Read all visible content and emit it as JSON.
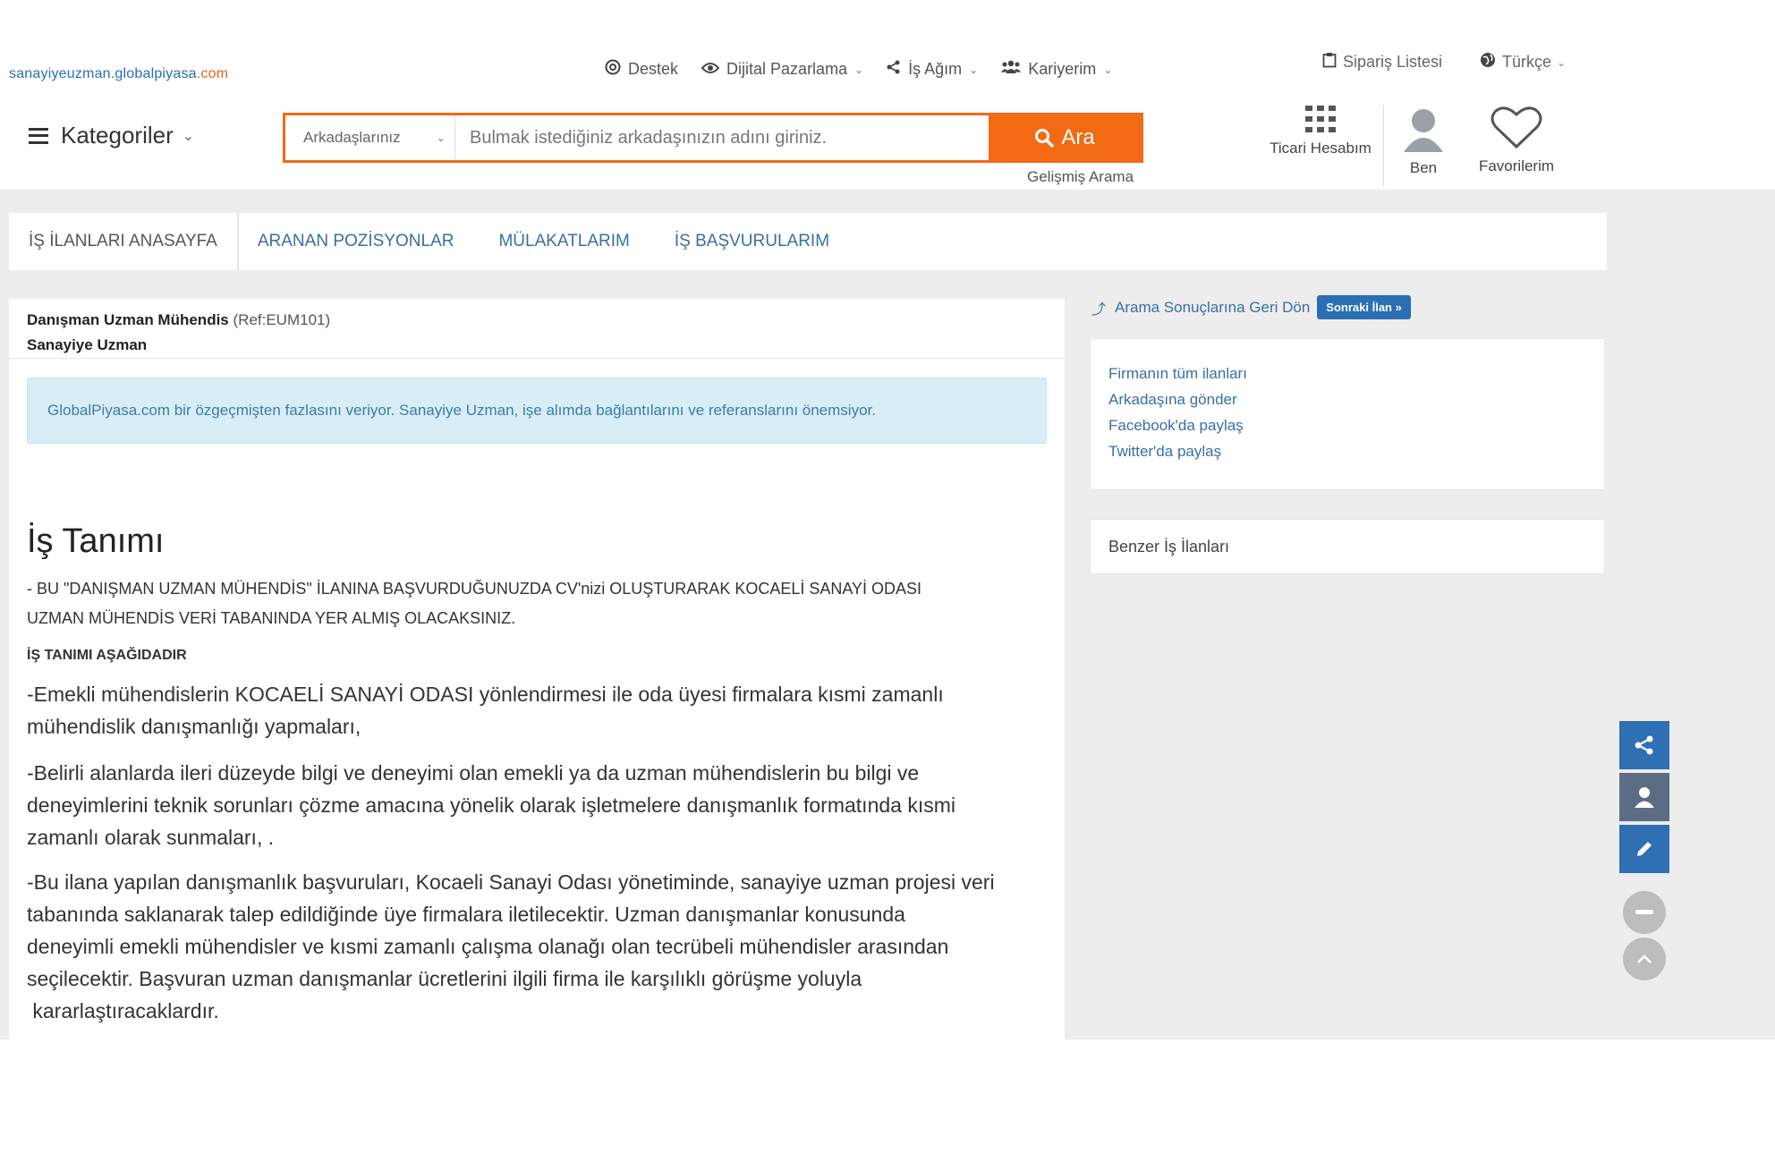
{
  "logo": {
    "part1": "sanayiyeuzman.globalpiyasa",
    "part2": ".com"
  },
  "topnav": [
    {
      "label": "Destek",
      "icon": "support-icon"
    },
    {
      "label": "Dijital Pazarlama",
      "icon": "eye-icon"
    },
    {
      "label": "İş Ağım",
      "icon": "share-icon"
    },
    {
      "label": "Kariyerim",
      "icon": "users-icon"
    }
  ],
  "topright": {
    "orders": "Sipariş Listesi",
    "language": "Türkçe"
  },
  "categories_label": "Kategoriler",
  "search": {
    "scope": "Arkadaşlarınız",
    "placeholder": "Bulmak istediğiniz arkadaşınızın adını giriniz.",
    "button": "Ara",
    "advanced": "Gelişmiş Arama"
  },
  "header_icons": {
    "business": "Ticari Hesabım",
    "me": "Ben",
    "favorites": "Favorilerim"
  },
  "tabs": [
    "İŞ İLANLARI ANASAYFA",
    "ARANAN POZİSYONLAR",
    "MÜLAKATLARIM",
    "İŞ BAŞVURULARIM"
  ],
  "job": {
    "title": "Danışman Uzman Mühendis",
    "ref": "(Ref:EUM101)",
    "company": "Sanayiye Uzman",
    "alert": "GlobalPiyasa.com bir özgeçmişten fazlasını veriyor.   Sanayiye Uzman, işe alımda bağlantılarını ve referanslarını önemsiyor.",
    "section_title": "İş Tanımı",
    "caps_line1": "- BU \"DANIŞMAN UZMAN MÜHENDİS\" İLANINA BAŞVURDUĞUNUZDA CV'nizi  OLUŞTURARAK KOCAELİ SANAYİ ODASI",
    "caps_line2": "UZMAN MÜHENDİS VERİ TABANINDA YER ALMIŞ OLACAKSINIZ.",
    "subheading": "İŞ TANIMI AŞAĞIDADIR",
    "p1_l1": "-Emekli mühendislerin KOCAELİ SANAYİ ODASI yönlendirmesi ile oda üyesi   firmalara kısmi zamanlı",
    "p1_l2": "mühendislik danışmanlığı yapmaları,",
    "p2_l1": "-Belirli alanlarda ileri düzeyde bilgi ve deneyimi olan emekli ya da uzman   mühendislerin bu bilgi ve",
    "p2_l2": "deneyimlerini teknik   sorunları çözme amacına yönelik   olarak işletmelere danışmanlık formatında kısmi",
    "p2_l3": "zamanlı olarak sunmaları,  .",
    "p3_l1": "-Bu ilana yapılan danışmanlık başvuruları, Kocaeli Sanayi Odası yönetiminde,   sanayiye uzman projesi veri",
    "p3_l2": "tabanında  saklanarak talep edildiğinde üye firmalara   iletilecektir. Uzman danışmanlar konusunda",
    "p3_l3": "deneyimli emekli mühendisler ve   kısmi zamanlı çalışma olanağı olan tecrübeli mühendisler arasından",
    "p3_l4": "seçilecektir.   Başvuran uzman danışmanlar ücretlerini ilgili firma ile karşılıklı görüşme yoluyla",
    "p3_l5": " kararlaştıracaklardır."
  },
  "sidebar": {
    "back": "Arama Sonuçlarına Geri Dön",
    "next": "Sonraki İlan »",
    "links": [
      "Firmanın tüm ilanları",
      "Arkadaşına gönder",
      "Facebook'da paylaş",
      "Twitter'da paylaş"
    ],
    "similar": "Benzer İş İlanları"
  },
  "colors": {
    "accent": "#f26a14",
    "link": "#3a6ea5",
    "blue": "#2f6fb3"
  }
}
